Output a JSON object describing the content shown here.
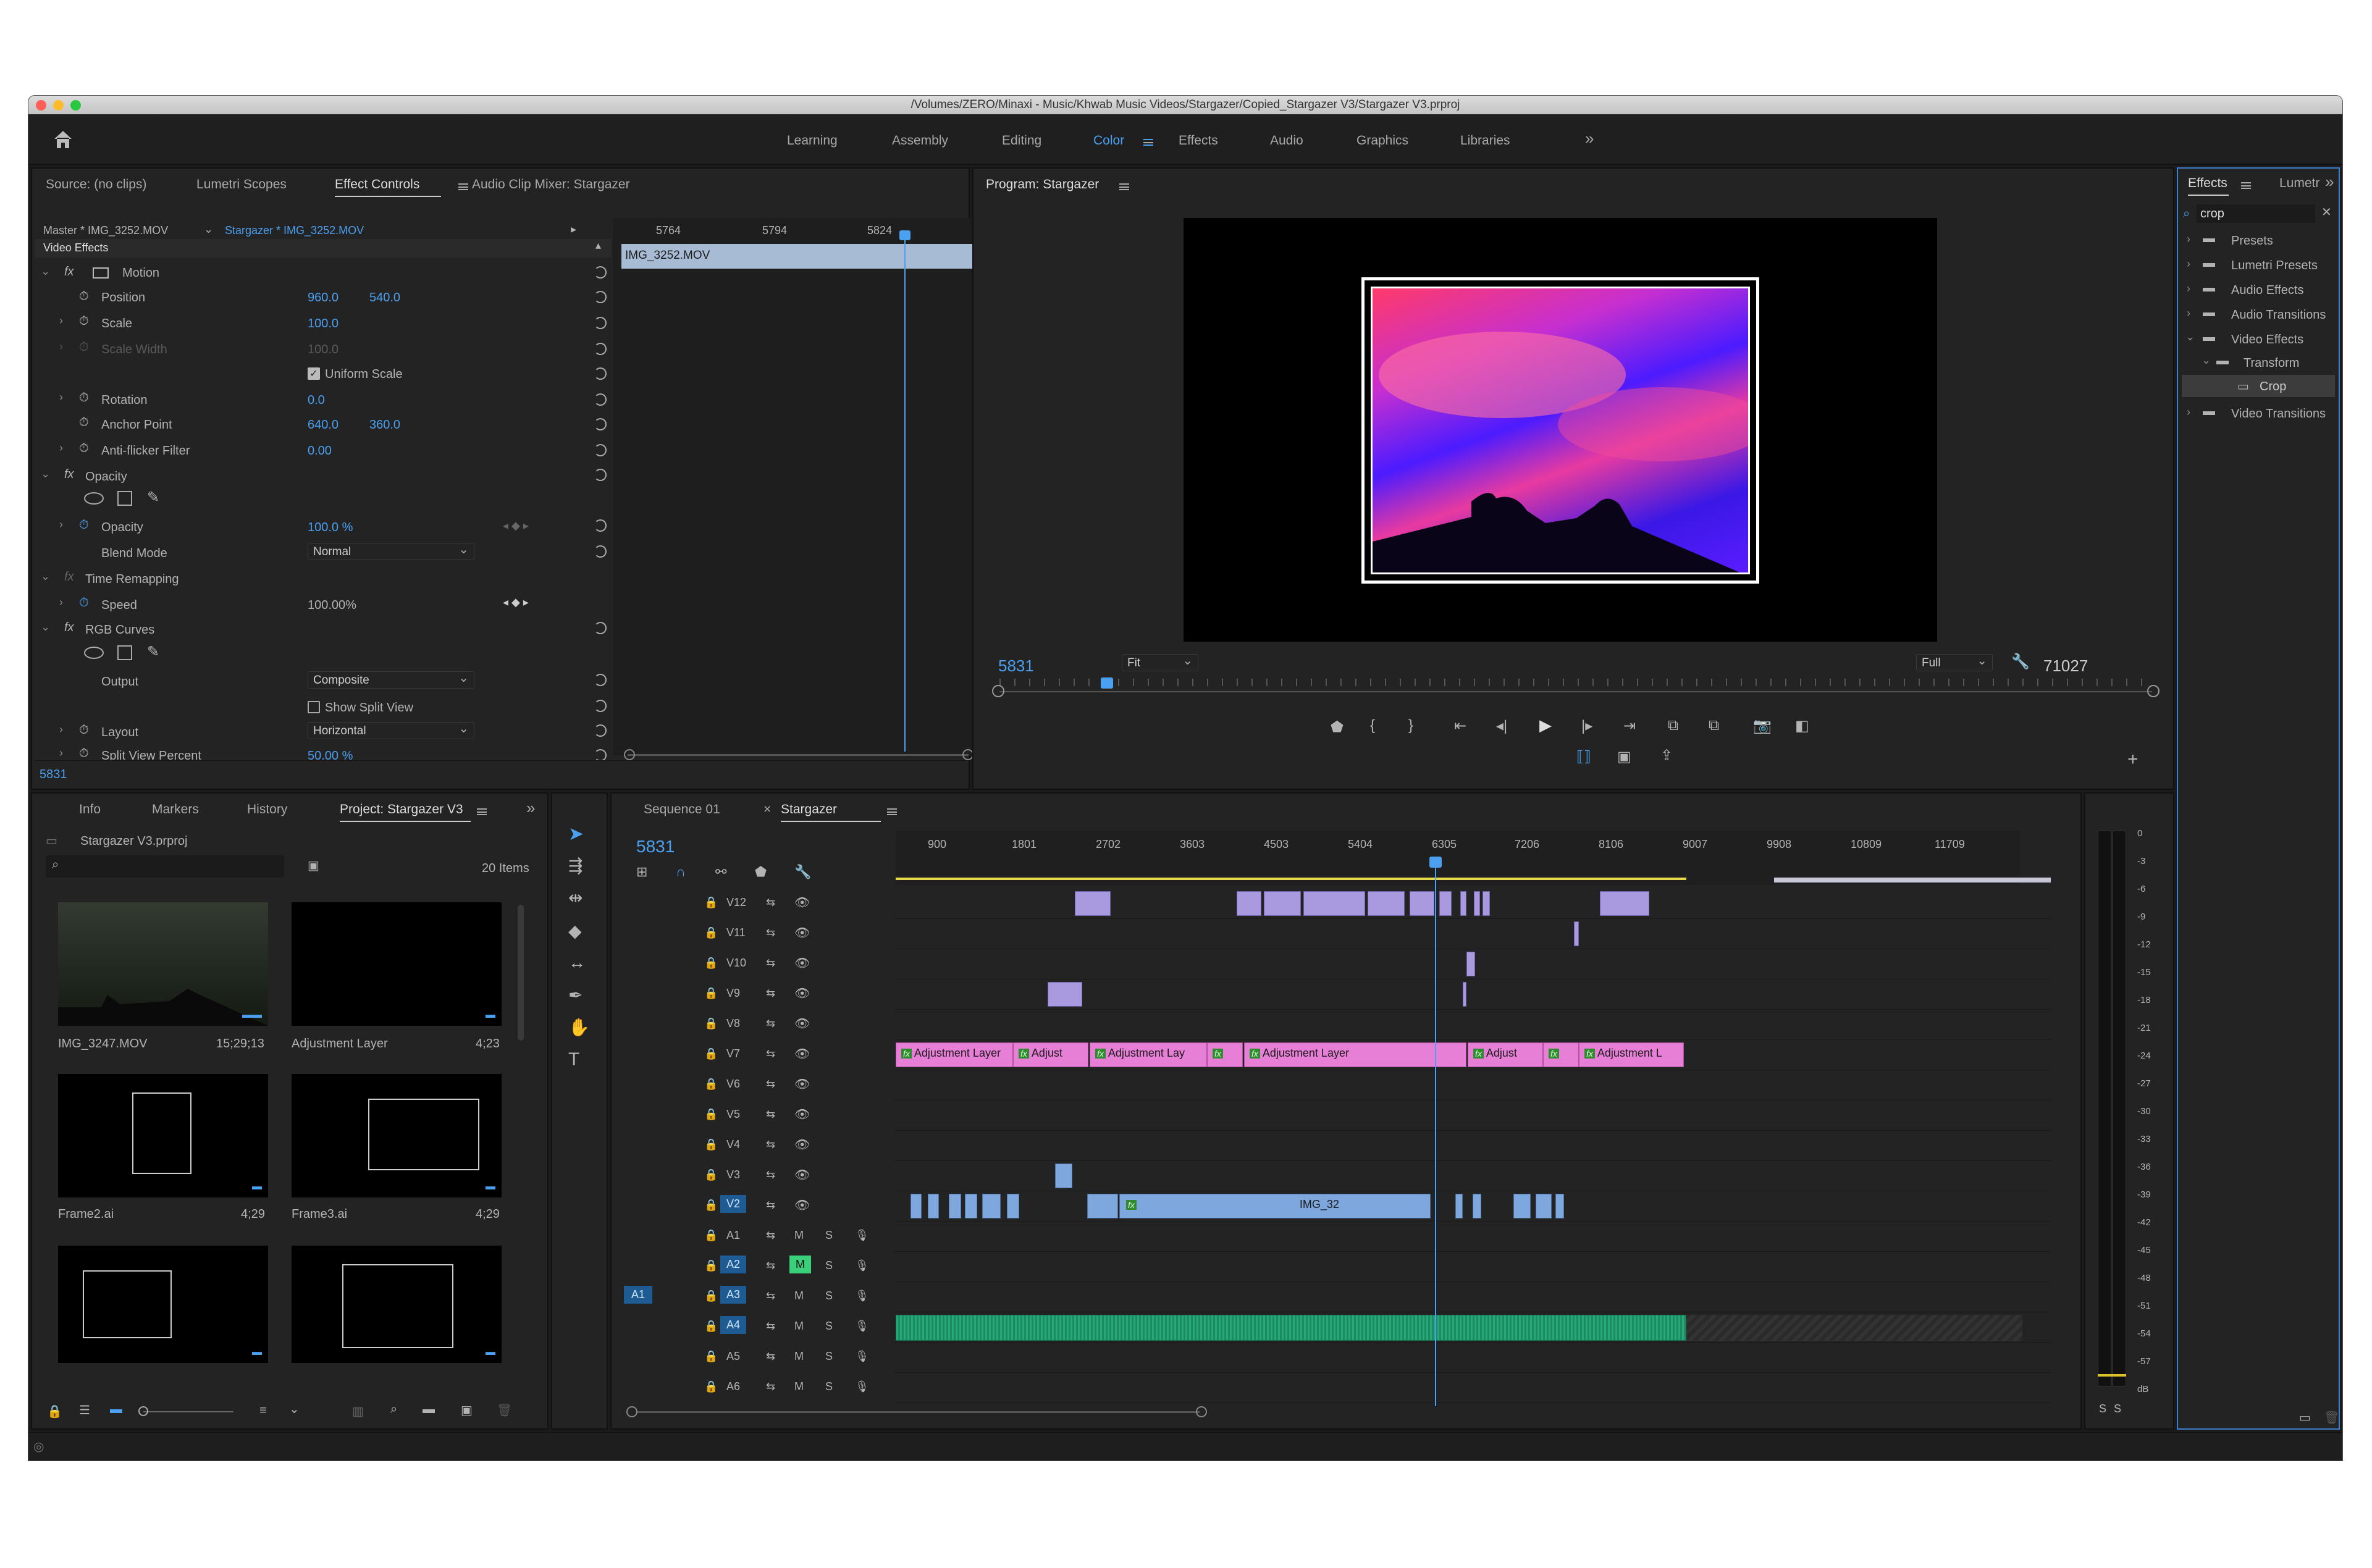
{
  "window": {
    "title": "/Volumes/ZERO/Minaxi - Music/Khwab Music Videos/Stargazer/Copied_Stargazer V3/Stargazer V3.prproj"
  },
  "workspaces": [
    "Learning",
    "Assembly",
    "Editing",
    "Color",
    "Effects",
    "Audio",
    "Graphics",
    "Libraries"
  ],
  "workspace_active": "Color",
  "top_left_tabs": {
    "source": "Source: (no clips)",
    "scopes": "Lumetri Scopes",
    "effect_controls": "Effect Controls",
    "audio_mixer": "Audio Clip Mixer: Stargazer"
  },
  "effect_controls": {
    "master": "Master * IMG_3252.MOV",
    "clip": "Stargazer * IMG_3252.MOV",
    "ruler": [
      "5764",
      "5794",
      "5824"
    ],
    "clip_bar": "IMG_3252.MOV",
    "video_effects": "Video Effects",
    "motion": "Motion",
    "position_label": "Position",
    "position_x": "960.0",
    "position_y": "540.0",
    "scale_label": "Scale",
    "scale": "100.0",
    "scale_width_label": "Scale Width",
    "scale_width": "100.0",
    "uniform_scale": "Uniform Scale",
    "rotation_label": "Rotation",
    "rotation": "0.0",
    "anchor_label": "Anchor Point",
    "anchor_x": "640.0",
    "anchor_y": "360.0",
    "antiflicker_label": "Anti-flicker Filter",
    "antiflicker": "0.00",
    "opacity_group": "Opacity",
    "opacity_label": "Opacity",
    "opacity": "100.0 %",
    "blend_label": "Blend Mode",
    "blend": "Normal",
    "time_remap": "Time Remapping",
    "speed_label": "Speed",
    "speed": "100.00%",
    "rgb_curves": "RGB Curves",
    "output_label": "Output",
    "output": "Composite",
    "split_view": "Show Split View",
    "layout_label": "Layout",
    "layout": "Horizontal",
    "split_percent_label": "Split View Percent",
    "split_percent": "50.00 %",
    "timecode": "5831"
  },
  "program": {
    "title": "Program: Stargazer",
    "timecode": "5831",
    "fit": "Fit",
    "quality": "Full",
    "duration": "71027"
  },
  "effects_panel": {
    "tab1": "Effects",
    "tab2": "Lumetr",
    "search": "crop",
    "items": [
      "Presets",
      "Lumetri Presets",
      "Audio Effects",
      "Audio Transitions",
      "Video Effects",
      "Transform",
      "Crop",
      "Video Transitions"
    ]
  },
  "project": {
    "tabs": [
      "Info",
      "Markers",
      "History",
      "Project: Stargazer V3"
    ],
    "file": "Stargazer V3.prproj",
    "count": "20 Items",
    "items": [
      {
        "name": "IMG_3247.MOV",
        "dur": "15;29;13"
      },
      {
        "name": "Adjustment Layer",
        "dur": "4;23"
      },
      {
        "name": "Frame2.ai",
        "dur": "4;29"
      },
      {
        "name": "Frame3.ai",
        "dur": "4;29"
      }
    ]
  },
  "timeline": {
    "tabs": [
      "Sequence 01",
      "Stargazer"
    ],
    "timecode": "5831",
    "ruler": [
      "900",
      "1801",
      "2702",
      "3603",
      "4503",
      "5404",
      "6305",
      "7206",
      "8106",
      "9007",
      "9908",
      "10809",
      "11709"
    ],
    "video_tracks": [
      "V12",
      "V11",
      "V10",
      "V9",
      "V8",
      "V7",
      "V6",
      "V5",
      "V4",
      "V3",
      "V2"
    ],
    "audio_tracks": [
      "A1",
      "A2",
      "A3",
      "A4",
      "A5",
      "A6"
    ],
    "src_patch": "A1",
    "m": "M",
    "s": "S",
    "adjustment_labels": [
      "Adjustment Layer",
      "Adjust",
      "Adjustment Lay",
      "Adjustment Layer",
      "Adjust",
      "Adjustment L"
    ],
    "img_label": "IMG_32",
    "fx": "fx"
  },
  "meter": {
    "scale": [
      "0",
      "-3",
      "-6",
      "-9",
      "-12",
      "-15",
      "-18",
      "-21",
      "-24",
      "-27",
      "-30",
      "-33",
      "-36",
      "-39",
      "-42",
      "-45",
      "-48",
      "-51",
      "-54",
      "-57",
      "dB"
    ],
    "solo": "S"
  }
}
